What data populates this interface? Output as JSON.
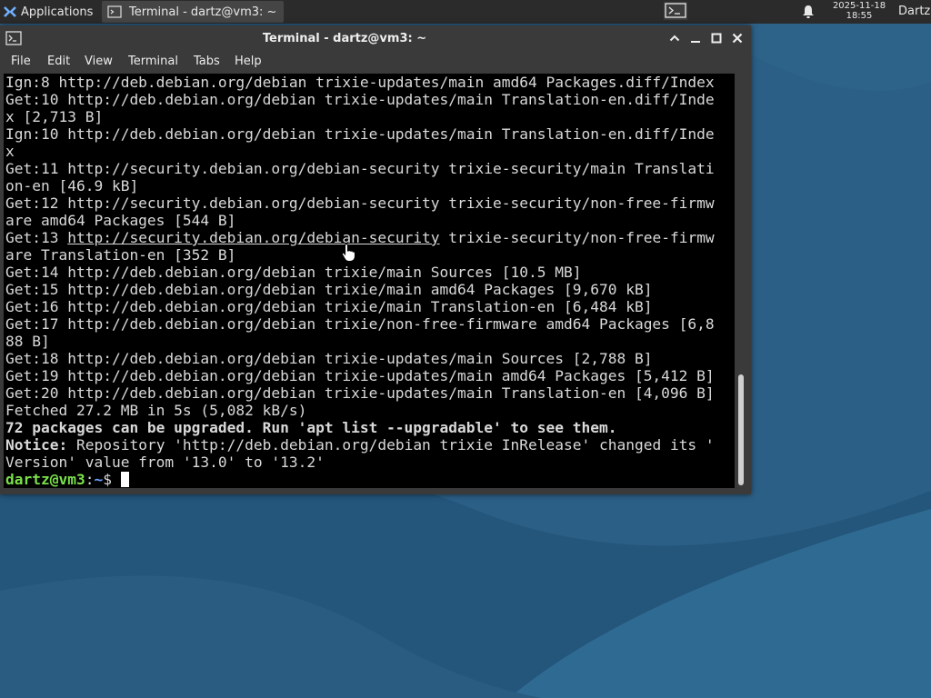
{
  "panel": {
    "applications_label": "Applications",
    "task_label": "Terminal - dartz@vm3: ~",
    "clock_date": "2025-11-18",
    "clock_time": "18:55",
    "user_label": "Dartz"
  },
  "window": {
    "title": "Terminal - dartz@vm3: ~",
    "menu": [
      "File",
      "Edit",
      "View",
      "Terminal",
      "Tabs",
      "Help"
    ]
  },
  "terminal": {
    "lines": [
      {
        "spans": [
          {
            "t": "Ign:8 http://deb.debian.org/debian trixie-updates/main amd64 Packages.diff/Index"
          }
        ]
      },
      {
        "spans": [
          {
            "t": "Get:10 http://deb.debian.org/debian trixie-updates/main Translation-en.diff/Inde"
          }
        ]
      },
      {
        "spans": [
          {
            "t": "x [2,713 B]"
          }
        ]
      },
      {
        "spans": [
          {
            "t": "Ign:10 http://deb.debian.org/debian trixie-updates/main Translation-en.diff/Inde"
          }
        ]
      },
      {
        "spans": [
          {
            "t": "x"
          }
        ]
      },
      {
        "spans": [
          {
            "t": "Get:11 http://security.debian.org/debian-security trixie-security/main Translati"
          }
        ]
      },
      {
        "spans": [
          {
            "t": "on-en [46.9 kB]"
          }
        ]
      },
      {
        "spans": [
          {
            "t": "Get:12 http://security.debian.org/debian-security trixie-security/non-free-firmw"
          }
        ]
      },
      {
        "spans": [
          {
            "t": "are amd64 Packages [544 B]"
          }
        ]
      },
      {
        "spans": [
          {
            "t": "Get:13 "
          },
          {
            "t": "http://security.debian.org/debian-security",
            "s": "u"
          },
          {
            "t": " trixie-security/non-free-firmw"
          }
        ]
      },
      {
        "spans": [
          {
            "t": "are Translation-en [352 B]"
          }
        ]
      },
      {
        "spans": [
          {
            "t": "Get:14 http://deb.debian.org/debian trixie/main Sources [10.5 MB]"
          }
        ]
      },
      {
        "spans": [
          {
            "t": "Get:15 http://deb.debian.org/debian trixie/main amd64 Packages [9,670 kB]"
          }
        ]
      },
      {
        "spans": [
          {
            "t": "Get:16 http://deb.debian.org/debian trixie/main Translation-en [6,484 kB]"
          }
        ]
      },
      {
        "spans": [
          {
            "t": "Get:17 http://deb.debian.org/debian trixie/non-free-firmware amd64 Packages [6,8"
          }
        ]
      },
      {
        "spans": [
          {
            "t": "88 B]"
          }
        ]
      },
      {
        "spans": [
          {
            "t": "Get:18 http://deb.debian.org/debian trixie-updates/main Sources [2,788 B]"
          }
        ]
      },
      {
        "spans": [
          {
            "t": "Get:19 http://deb.debian.org/debian trixie-updates/main amd64 Packages [5,412 B]"
          }
        ]
      },
      {
        "spans": [
          {
            "t": "Get:20 http://deb.debian.org/debian trixie-updates/main Translation-en [4,096 B]"
          }
        ]
      },
      {
        "spans": [
          {
            "t": "Fetched 27.2 MB in 5s (5,082 kB/s)"
          }
        ]
      },
      {
        "spans": [
          {
            "t": "72 packages can be upgraded. Run 'apt list --upgradable' to see them.",
            "s": "b"
          }
        ]
      },
      {
        "spans": [
          {
            "t": "Notice:",
            "s": "b"
          },
          {
            "t": " Repository 'http://deb.debian.org/debian trixie InRelease' changed its '"
          }
        ]
      },
      {
        "spans": [
          {
            "t": "Version' value from '13.0' to '13.2'"
          }
        ]
      }
    ],
    "prompt_user": "dartz@vm3",
    "prompt_sep": ":",
    "prompt_path": "~",
    "prompt_symbol": "$ "
  },
  "colors": {
    "panel_bg": "#2b2b2b",
    "window_bg": "#3a3a3a",
    "terminal_bg": "#000000",
    "terminal_fg": "#d9d9d9",
    "prompt_user": "#7ae04a",
    "prompt_path": "#6aa0ff",
    "wallpaper": "#2b5f86"
  },
  "icons": [
    "xfce-logo-icon",
    "terminal-icon",
    "bell-icon",
    "maximize-up-icon",
    "minimize-icon",
    "restore-icon",
    "close-icon",
    "mouse-pointer-icon"
  ]
}
